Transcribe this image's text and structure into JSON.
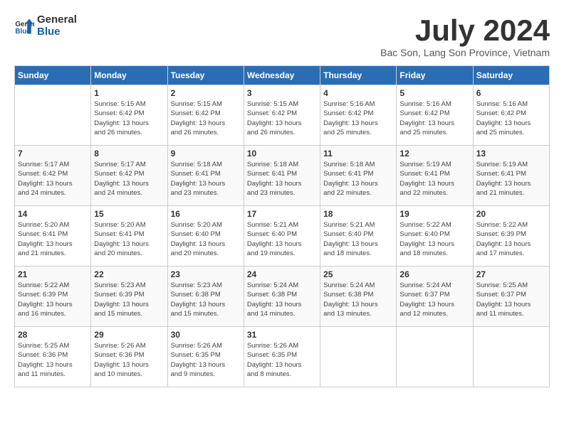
{
  "header": {
    "logo_line1": "General",
    "logo_line2": "Blue",
    "title": "July 2024",
    "subtitle": "Bac Son, Lang Son Province, Vietnam"
  },
  "days_of_week": [
    "Sunday",
    "Monday",
    "Tuesday",
    "Wednesday",
    "Thursday",
    "Friday",
    "Saturday"
  ],
  "weeks": [
    [
      {
        "day": "",
        "info": ""
      },
      {
        "day": "1",
        "info": "Sunrise: 5:15 AM\nSunset: 6:42 PM\nDaylight: 13 hours\nand 26 minutes."
      },
      {
        "day": "2",
        "info": "Sunrise: 5:15 AM\nSunset: 6:42 PM\nDaylight: 13 hours\nand 26 minutes."
      },
      {
        "day": "3",
        "info": "Sunrise: 5:15 AM\nSunset: 6:42 PM\nDaylight: 13 hours\nand 26 minutes."
      },
      {
        "day": "4",
        "info": "Sunrise: 5:16 AM\nSunset: 6:42 PM\nDaylight: 13 hours\nand 25 minutes."
      },
      {
        "day": "5",
        "info": "Sunrise: 5:16 AM\nSunset: 6:42 PM\nDaylight: 13 hours\nand 25 minutes."
      },
      {
        "day": "6",
        "info": "Sunrise: 5:16 AM\nSunset: 6:42 PM\nDaylight: 13 hours\nand 25 minutes."
      }
    ],
    [
      {
        "day": "7",
        "info": "Sunrise: 5:17 AM\nSunset: 6:42 PM\nDaylight: 13 hours\nand 24 minutes."
      },
      {
        "day": "8",
        "info": "Sunrise: 5:17 AM\nSunset: 6:42 PM\nDaylight: 13 hours\nand 24 minutes."
      },
      {
        "day": "9",
        "info": "Sunrise: 5:18 AM\nSunset: 6:41 PM\nDaylight: 13 hours\nand 23 minutes."
      },
      {
        "day": "10",
        "info": "Sunrise: 5:18 AM\nSunset: 6:41 PM\nDaylight: 13 hours\nand 23 minutes."
      },
      {
        "day": "11",
        "info": "Sunrise: 5:18 AM\nSunset: 6:41 PM\nDaylight: 13 hours\nand 22 minutes."
      },
      {
        "day": "12",
        "info": "Sunrise: 5:19 AM\nSunset: 6:41 PM\nDaylight: 13 hours\nand 22 minutes."
      },
      {
        "day": "13",
        "info": "Sunrise: 5:19 AM\nSunset: 6:41 PM\nDaylight: 13 hours\nand 21 minutes."
      }
    ],
    [
      {
        "day": "14",
        "info": "Sunrise: 5:20 AM\nSunset: 6:41 PM\nDaylight: 13 hours\nand 21 minutes."
      },
      {
        "day": "15",
        "info": "Sunrise: 5:20 AM\nSunset: 6:41 PM\nDaylight: 13 hours\nand 20 minutes."
      },
      {
        "day": "16",
        "info": "Sunrise: 5:20 AM\nSunset: 6:40 PM\nDaylight: 13 hours\nand 20 minutes."
      },
      {
        "day": "17",
        "info": "Sunrise: 5:21 AM\nSunset: 6:40 PM\nDaylight: 13 hours\nand 19 minutes."
      },
      {
        "day": "18",
        "info": "Sunrise: 5:21 AM\nSunset: 6:40 PM\nDaylight: 13 hours\nand 18 minutes."
      },
      {
        "day": "19",
        "info": "Sunrise: 5:22 AM\nSunset: 6:40 PM\nDaylight: 13 hours\nand 18 minutes."
      },
      {
        "day": "20",
        "info": "Sunrise: 5:22 AM\nSunset: 6:39 PM\nDaylight: 13 hours\nand 17 minutes."
      }
    ],
    [
      {
        "day": "21",
        "info": "Sunrise: 5:22 AM\nSunset: 6:39 PM\nDaylight: 13 hours\nand 16 minutes."
      },
      {
        "day": "22",
        "info": "Sunrise: 5:23 AM\nSunset: 6:39 PM\nDaylight: 13 hours\nand 15 minutes."
      },
      {
        "day": "23",
        "info": "Sunrise: 5:23 AM\nSunset: 6:38 PM\nDaylight: 13 hours\nand 15 minutes."
      },
      {
        "day": "24",
        "info": "Sunrise: 5:24 AM\nSunset: 6:38 PM\nDaylight: 13 hours\nand 14 minutes."
      },
      {
        "day": "25",
        "info": "Sunrise: 5:24 AM\nSunset: 6:38 PM\nDaylight: 13 hours\nand 13 minutes."
      },
      {
        "day": "26",
        "info": "Sunrise: 5:24 AM\nSunset: 6:37 PM\nDaylight: 13 hours\nand 12 minutes."
      },
      {
        "day": "27",
        "info": "Sunrise: 5:25 AM\nSunset: 6:37 PM\nDaylight: 13 hours\nand 11 minutes."
      }
    ],
    [
      {
        "day": "28",
        "info": "Sunrise: 5:25 AM\nSunset: 6:36 PM\nDaylight: 13 hours\nand 11 minutes."
      },
      {
        "day": "29",
        "info": "Sunrise: 5:26 AM\nSunset: 6:36 PM\nDaylight: 13 hours\nand 10 minutes."
      },
      {
        "day": "30",
        "info": "Sunrise: 5:26 AM\nSunset: 6:35 PM\nDaylight: 13 hours\nand 9 minutes."
      },
      {
        "day": "31",
        "info": "Sunrise: 5:26 AM\nSunset: 6:35 PM\nDaylight: 13 hours\nand 8 minutes."
      },
      {
        "day": "",
        "info": ""
      },
      {
        "day": "",
        "info": ""
      },
      {
        "day": "",
        "info": ""
      }
    ]
  ]
}
